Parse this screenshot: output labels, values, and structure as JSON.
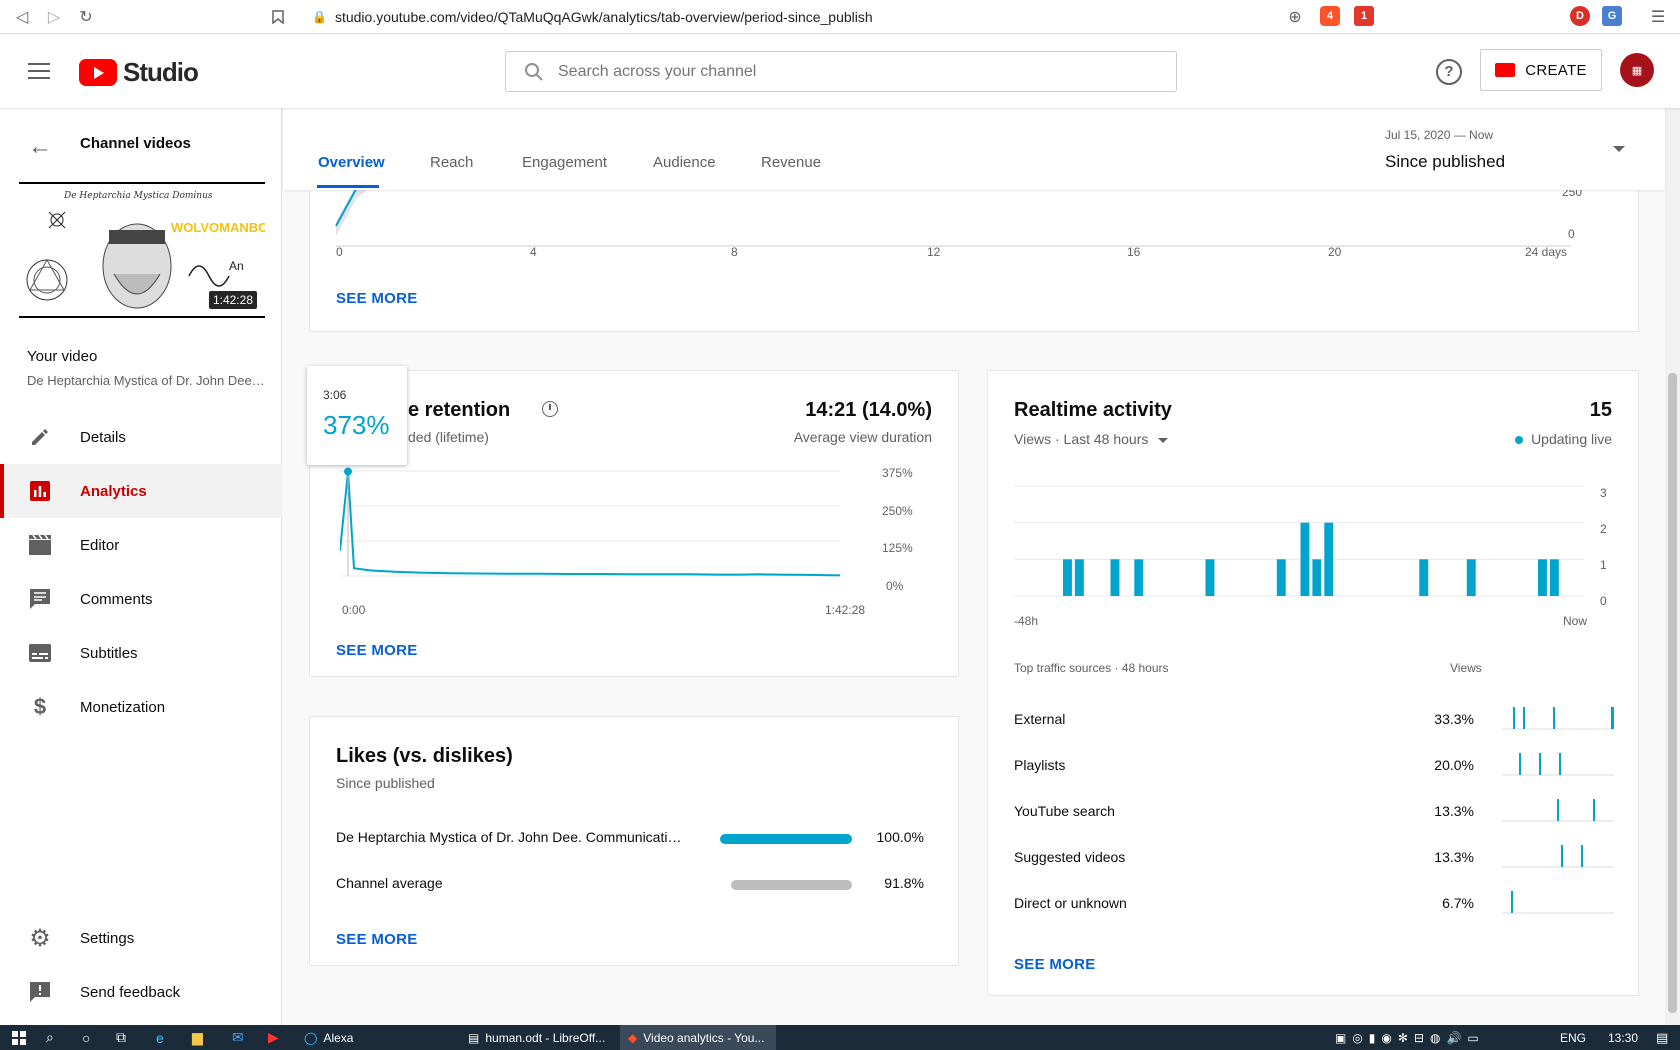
{
  "browser": {
    "url": "studio.youtube.com/video/QTaMuQqAGwk/analytics/tab-overview/period-since_publish",
    "brave_badge": "4",
    "ext_badge": "1",
    "profile_initial": "D"
  },
  "header": {
    "logo_text": "Studio",
    "search_placeholder": "Search across your channel",
    "help": "?",
    "create_label": "CREATE"
  },
  "sidebar": {
    "back_label": "Channel videos",
    "thumb_brand": "WOLVOMANBO",
    "thumb_duration": "1:42:28",
    "your_video": "Your video",
    "video_title": "De Heptarchia Mystica of Dr. John Dee. Communicating with Angels",
    "items": [
      {
        "label": "Details",
        "icon": "pencil-icon"
      },
      {
        "label": "Analytics",
        "icon": "analytics-icon"
      },
      {
        "label": "Editor",
        "icon": "film-icon"
      },
      {
        "label": "Comments",
        "icon": "comment-icon"
      },
      {
        "label": "Subtitles",
        "icon": "subtitles-icon"
      },
      {
        "label": "Monetization",
        "icon": "dollar-icon"
      },
      {
        "label": "Settings",
        "icon": "gear-icon"
      },
      {
        "label": "Send feedback",
        "icon": "feedback-icon"
      }
    ]
  },
  "tabs": {
    "items": [
      "Overview",
      "Reach",
      "Engagement",
      "Audience",
      "Revenue"
    ],
    "active": "Overview",
    "period_range": "Jul 15, 2020 — Now",
    "period_label": "Since published"
  },
  "top_chart": {
    "y_ticks": [
      "250",
      "0"
    ],
    "x_ticks": [
      "0",
      "4",
      "8",
      "12",
      "16",
      "20",
      "24 days"
    ],
    "see_more": "SEE MORE"
  },
  "retention": {
    "title_visible": "e retention",
    "subtitle_visible": "ded (lifetime)",
    "value": "14:21 (14.0%)",
    "value_label": "Average view duration",
    "tooltip_time": "3:06",
    "tooltip_value": "373%",
    "y_ticks": [
      "375%",
      "250%",
      "125%",
      "0%"
    ],
    "x_start": "0:00",
    "x_end": "1:42:28",
    "see_more": "SEE MORE"
  },
  "likes": {
    "title": "Likes (vs. dislikes)",
    "subtitle": "Since published",
    "rows": [
      {
        "label": "De Heptarchia Mystica of Dr. John Dee. Communicating with Angels",
        "value": "100.0%",
        "fraction": 1.0,
        "color": "#00a4cc"
      },
      {
        "label": "Channel average",
        "value": "91.8%",
        "fraction": 0.918,
        "color": "#bdbdbd"
      }
    ],
    "see_more": "SEE MORE"
  },
  "realtime": {
    "title": "Realtime activity",
    "count": "15",
    "filter": "Views · Last 48 hours",
    "live": "Updating live",
    "y_ticks": [
      "3",
      "2",
      "1",
      "0"
    ],
    "x_start": "-48h",
    "x_end": "Now",
    "sources_title": "Top traffic sources · 48 hours",
    "views_label": "Views",
    "sources": [
      {
        "name": "External",
        "pct": "33.3%"
      },
      {
        "name": "Playlists",
        "pct": "20.0%"
      },
      {
        "name": "YouTube search",
        "pct": "13.3%"
      },
      {
        "name": "Suggested videos",
        "pct": "13.3%"
      },
      {
        "name": "Direct or unknown",
        "pct": "6.7%"
      }
    ],
    "see_more": "SEE MORE"
  },
  "taskbar": {
    "apps": [
      "Alexa",
      "human.odt - LibreOff...",
      "Video analytics - You..."
    ],
    "lang": "ENG",
    "time": "13:30"
  },
  "chart_data": [
    {
      "type": "line",
      "title": "Audience retention",
      "x": [
        "0:00",
        "1:42:28"
      ],
      "series": [
        {
          "values": [
            90,
            373,
            28,
            20,
            15,
            12,
            10,
            9,
            8,
            8,
            7,
            7,
            6,
            6,
            6,
            5,
            5,
            6,
            5,
            4,
            2
          ]
        }
      ],
      "ylim": [
        0,
        375
      ],
      "y_ticks": [
        "375%",
        "250%",
        "125%",
        "0%"
      ]
    },
    {
      "type": "bar",
      "title": "Realtime activity",
      "xlabel": "",
      "ylim": [
        0,
        3
      ],
      "values": [
        0,
        0,
        0,
        0,
        1,
        1,
        0,
        0,
        1,
        0,
        1,
        0,
        0,
        0,
        0,
        0,
        1,
        0,
        0,
        0,
        0,
        0,
        1,
        0,
        2,
        1,
        2,
        0,
        0,
        0,
        0,
        0,
        0,
        0,
        1,
        0,
        0,
        0,
        1,
        0,
        0,
        0,
        0,
        0,
        1,
        1,
        0,
        0
      ]
    },
    {
      "type": "area",
      "title": "Views",
      "x": [
        0,
        4,
        8,
        12,
        16,
        20,
        24
      ],
      "series": [
        {
          "values": [
            0,
            250
          ]
        }
      ],
      "x_ticks": [
        "0",
        "4",
        "8",
        "12",
        "16",
        "20",
        "24 days"
      ],
      "y_ticks": [
        "250",
        "0"
      ]
    }
  ]
}
